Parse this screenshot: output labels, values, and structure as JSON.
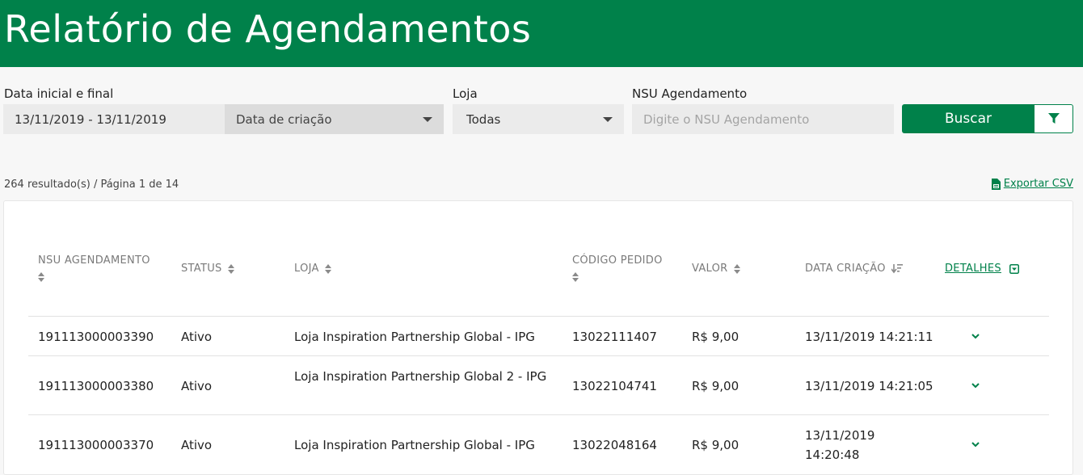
{
  "header": {
    "title": "Relatório de Agendamentos"
  },
  "filters": {
    "date_label": "Data inicial e final",
    "date_value": "13/11/2019 - 13/11/2019",
    "date_type": "Data de criação",
    "store_label": "Loja",
    "store_value": "Todas",
    "nsu_label": "NSU Agendamento",
    "nsu_placeholder": "Digite o NSU Agendamento",
    "search_label": "Buscar"
  },
  "results": {
    "summary": "264 resultado(s) / Página 1 de 14",
    "export_label": "Exportar CSV"
  },
  "table": {
    "headers": {
      "nsu": "NSU AGENDAMENTO",
      "status": "STATUS",
      "store": "LOJA",
      "order": "CÓDIGO PEDIDO",
      "value": "VALOR",
      "created": "DATA CRIAÇÃO",
      "details": "DETALHES"
    },
    "rows": [
      {
        "nsu": "191113000003390",
        "status": "Ativo",
        "store": "Loja Inspiration Partnership Global - IPG",
        "order": "13022111407",
        "value": "R$ 9,00",
        "created": "13/11/2019 14:21:11"
      },
      {
        "nsu": "191113000003380",
        "status": "Ativo",
        "store": "Loja Inspiration Partnership Global 2 - IPG",
        "order": "13022104741",
        "value": "R$ 9,00",
        "created": "13/11/2019 14:21:05"
      },
      {
        "nsu": "191113000003370",
        "status": "Ativo",
        "store": "Loja Inspiration Partnership Global - IPG",
        "order": "13022048164",
        "value": "R$ 9,00",
        "created": "13/11/2019 14:20:48"
      }
    ]
  },
  "colors": {
    "brand": "#00814a",
    "header_text": "#ffffff"
  },
  "icons": {
    "sort": "sort-updown-icon",
    "sort_active": "sort-desc-icon",
    "filter": "filter-icon",
    "csv": "csv-file-icon",
    "expand": "chevron-down-icon",
    "select_toggle": "caret-box-icon"
  }
}
